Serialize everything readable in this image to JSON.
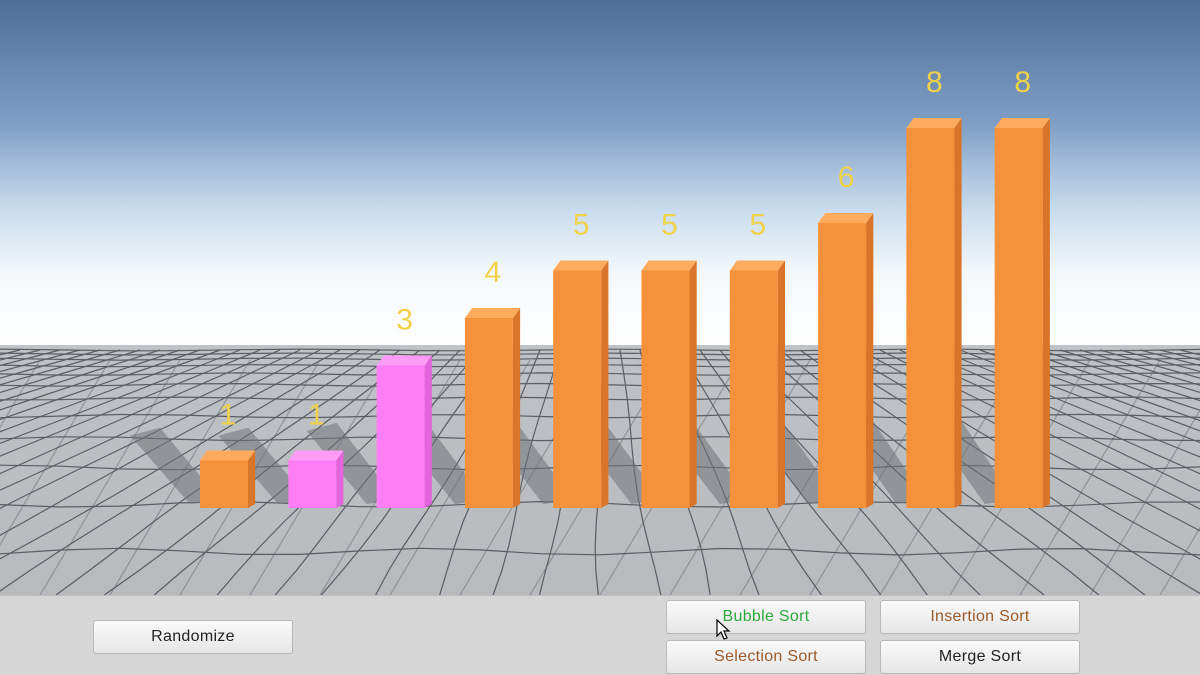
{
  "scene": {
    "bars": [
      {
        "value": 1,
        "label": "1",
        "state": "default"
      },
      {
        "value": 1,
        "label": "1",
        "state": "highlight"
      },
      {
        "value": 3,
        "label": "3",
        "state": "highlight"
      },
      {
        "value": 4,
        "label": "4",
        "state": "default"
      },
      {
        "value": 5,
        "label": "5",
        "state": "default"
      },
      {
        "value": 5,
        "label": "5",
        "state": "default"
      },
      {
        "value": 5,
        "label": "5",
        "state": "default"
      },
      {
        "value": 6,
        "label": "6",
        "state": "default"
      },
      {
        "value": 8,
        "label": "8",
        "state": "default"
      },
      {
        "value": 8,
        "label": "8",
        "state": "default"
      }
    ],
    "colors": {
      "bar": "#f5913a",
      "bar_side": "#d9752a",
      "bar_top": "#ffab5e",
      "highlight": "#ff7ef5",
      "highlight_side": "#e364dc",
      "highlight_top": "#ff9cf7",
      "label": "#f0d24a"
    }
  },
  "controls": {
    "randomize": {
      "label": "Randomize",
      "color": "#222222"
    },
    "bubble": {
      "label": "Bubble Sort",
      "color": "#2ea83c"
    },
    "insertion": {
      "label": "Insertion Sort",
      "color": "#9a5a2a"
    },
    "selection": {
      "label": "Selection Sort",
      "color": "#9a5a2a"
    },
    "merge": {
      "label": "Merge Sort",
      "color": "#222222"
    }
  }
}
